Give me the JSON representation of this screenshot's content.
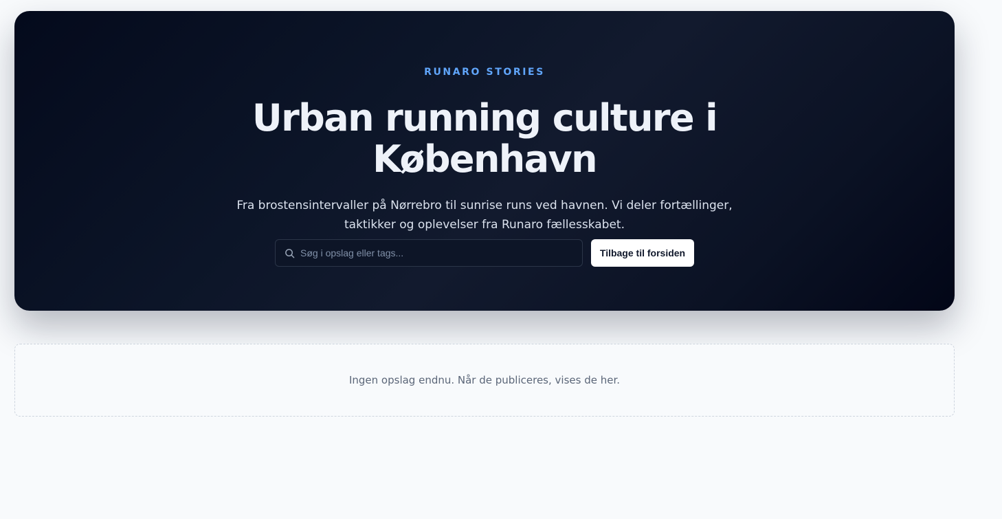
{
  "hero": {
    "eyebrow": "RUNARO STORIES",
    "title": "Urban running culture i København",
    "subtitle": "Fra brostensintervaller på Nørrebro til sunrise runs ved havnen. Vi deler fortællinger, taktikker og oplevelser fra Runaro fællesskabet.",
    "background_color": "#0b1224"
  },
  "search": {
    "placeholder": "Søg i opslag eller tags...",
    "value": "",
    "icon": "search-icon"
  },
  "actions": {
    "back_label": "Tilbage til forsiden"
  },
  "empty_state": {
    "message": "Ingen opslag endnu. Når de publiceres, vises de her."
  },
  "colors": {
    "accent": "#60a5fa",
    "page_background": "#f8fafc"
  }
}
